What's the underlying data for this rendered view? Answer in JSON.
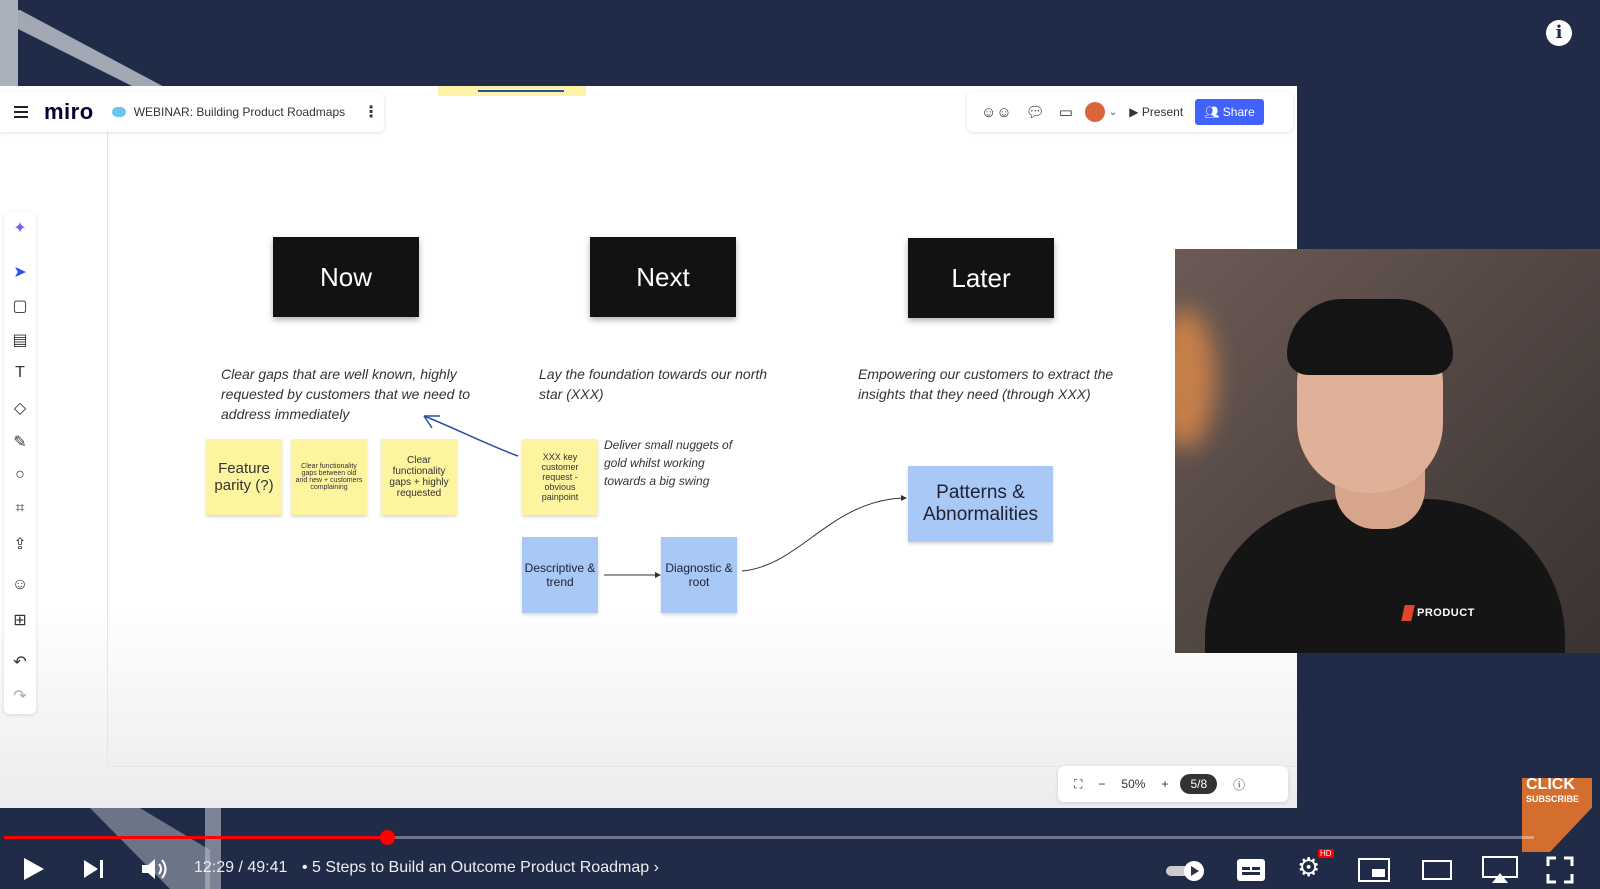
{
  "board": {
    "logo": "miro",
    "title": "WEBINAR: Building Product Roadmaps",
    "present_label": "Present",
    "share_label": "Share",
    "zoom": "50%",
    "page_indicator": "5/8"
  },
  "columns": [
    {
      "heading": "Now",
      "description": "Clear gaps that are well known, highly requested by customers that we need to address immediately"
    },
    {
      "heading": "Next",
      "description": "Lay the foundation towards our north star (XXX)"
    },
    {
      "heading": "Later",
      "description": "Empowering our customers to extract the insights that they need (through XXX)"
    }
  ],
  "stickies": {
    "feature_parity": "Feature parity (?)",
    "clear_gaps_small": "Clear functionality gaps between old and new + customers complaining",
    "clear_gaps": "Clear functionality gaps + highly requested",
    "key_request": "XXX key customer request - obvious painpoint"
  },
  "note_next": "Deliver small nuggets of gold whilst working towards a big swing",
  "blue_boxes": {
    "descriptive": "Descriptive & trend",
    "diagnostic": "Diagnostic & root",
    "patterns": "Patterns & Abnormalities"
  },
  "webcam": {
    "shirt_brand": "PRODUCT"
  },
  "player": {
    "time": "12:29 / 49:41",
    "chapter": "•  5 Steps to Build an Outcome Product Roadmap",
    "progress": 0.25,
    "subscribe_top": "CLICK",
    "subscribe_bottom": "SUBSCRIBE",
    "hd_badge": "HD"
  },
  "icons": [
    "info-icon",
    "menu-icon",
    "cloud-icon",
    "kebab-icon",
    "reactions-icon",
    "chat-icon",
    "video-icon",
    "avatar",
    "play-icon",
    "next-icon",
    "volume-icon",
    "autoplay-toggle",
    "captions-icon",
    "settings-icon",
    "miniplayer-icon",
    "theater-icon",
    "airplay-icon",
    "fullscreen-icon"
  ]
}
